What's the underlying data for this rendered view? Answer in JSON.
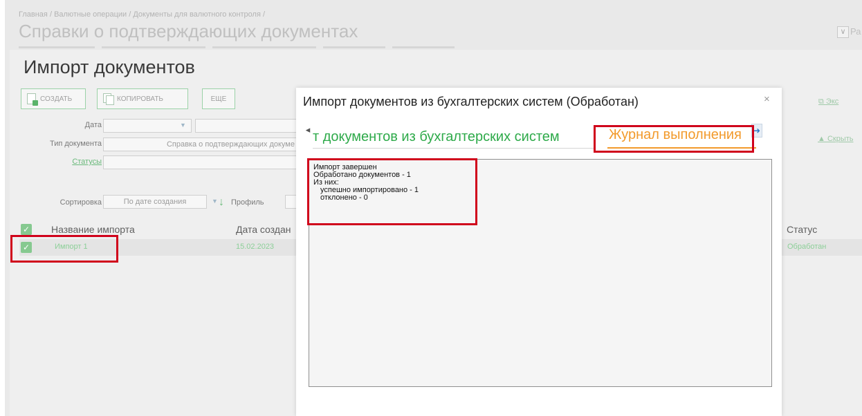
{
  "breadcrumb": [
    "Главная",
    "Валютные операции",
    "Документы для валютного контроля"
  ],
  "breadcrumb_sep": "/",
  "page_title": "Справки о подтверждающих документах",
  "top_right_text": "Ра",
  "panel": {
    "title": "Импорт документов",
    "buttons": {
      "create": "СОЗДАТЬ",
      "copy": "КОПИРОВАТЬ",
      "more": "ЕЩЕ"
    },
    "filters": {
      "date_label": "Дата",
      "doc_type_label": "Тип документа",
      "doc_type_value": "Справка о подтверждающих докуме",
      "statuses_label": "Статусы",
      "sort_label": "Сортировка",
      "sort_value": "По дате создания",
      "profile_label": "Профиль"
    },
    "table": {
      "headers": {
        "name": "Название импорта",
        "date": "Дата создан",
        "status": "Статус"
      },
      "rows": [
        {
          "name": "Импорт 1",
          "date": "15.02.2023",
          "status": "Обработан"
        }
      ]
    },
    "right_links": {
      "export": "Экс",
      "hide": "Скрыть"
    }
  },
  "modal": {
    "title": "Импорт документов из бухгалтерских систем (Обработан)",
    "close": "×",
    "tabs": {
      "import": "т документов из бухгалтерских систем",
      "log": "Журнал выполнения"
    },
    "log_lines": [
      "Импорт завершен",
      "Обработано документов - 1",
      "Из них:",
      "   успешно импортировано - 1",
      "   отклонено - 0"
    ]
  },
  "colors": {
    "accent_green": "#2eaa4a",
    "active_tab_orange": "#f29a2b",
    "highlight_red": "#d0021b"
  }
}
